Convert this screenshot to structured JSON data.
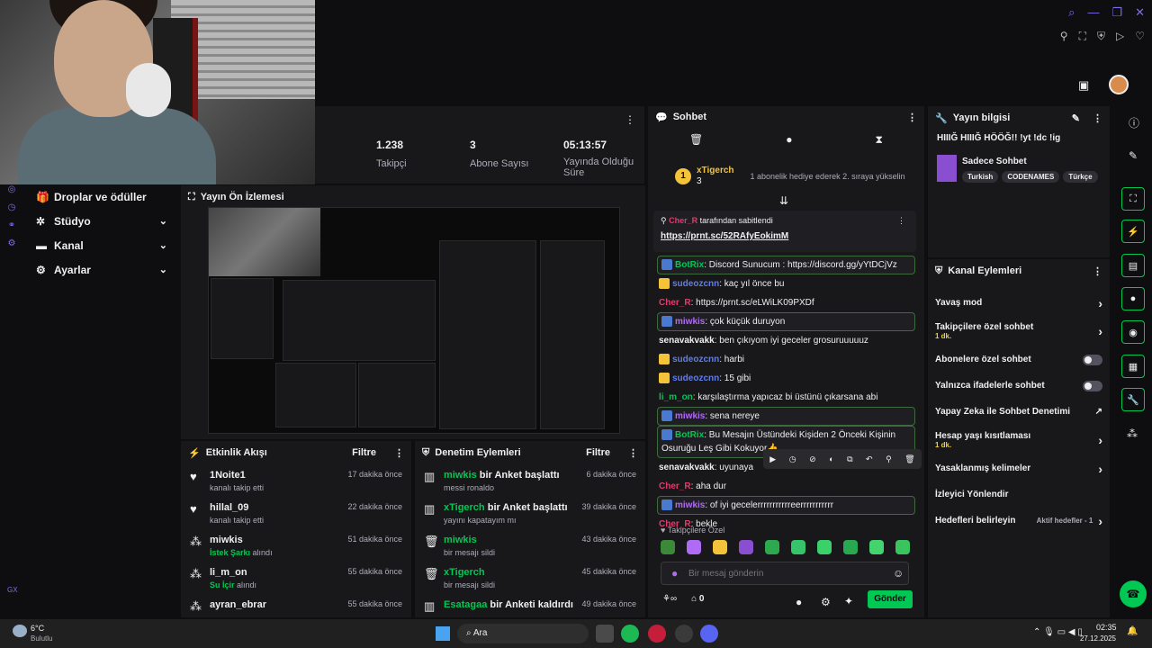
{
  "top": {
    "icons": [
      "search-icon",
      "minimize-icon",
      "restore-icon",
      "close-icon"
    ],
    "toolbar_icons": [
      "pin-icon",
      "crop-icon",
      "shield-icon",
      "play-icon",
      "heart-icon"
    ]
  },
  "side_nav": {
    "items": [
      {
        "label": "Droplar ve ödüller",
        "icon": "gift-icon"
      },
      {
        "label": "Stüdyo",
        "icon": "studio-icon"
      },
      {
        "label": "Kanal",
        "icon": "channel-icon"
      },
      {
        "label": "Ayarlar",
        "icon": "gear-icon"
      }
    ]
  },
  "stats": [
    {
      "value": "1.238",
      "label": "Takipçi"
    },
    {
      "value": "3",
      "label": "Abone Sayısı"
    },
    {
      "value": "05:13:57",
      "label": "Yayında Olduğu Süre"
    }
  ],
  "preview": {
    "title": "Yayın Ön İzlemesi"
  },
  "feed": {
    "title": "Etkinlik Akışı",
    "filter": "Filtre",
    "items": [
      {
        "name": "1Noite1",
        "sub": "kanalı takip etti",
        "time": "17 dakika önce",
        "icon": "heart-icon"
      },
      {
        "name": "hillal_09",
        "sub": "kanalı takip etti",
        "time": "22 dakika önce",
        "icon": "heart-icon"
      },
      {
        "name": "miwkis",
        "sub_hl": "İstek Şarkı",
        "sub": "alındı",
        "time": "51 dakika önce",
        "icon": "points-icon"
      },
      {
        "name": "li_m_on",
        "sub_hl": "Su İçir",
        "sub": "alındı",
        "time": "55 dakika önce",
        "icon": "points-icon"
      },
      {
        "name": "ayran_ebrar",
        "sub": "",
        "time": "55 dakika önce",
        "icon": "points-icon"
      }
    ]
  },
  "mod": {
    "title": "Denetim Eylemleri",
    "filter": "Filtre",
    "items": [
      {
        "name": "miwkis",
        "action": "bir Anket başlattı",
        "sub": "messi ronaldo",
        "time": "6 dakika önce",
        "icon": "poll-icon"
      },
      {
        "name": "xTigerch",
        "action": "bir Anket başlattı",
        "sub": "yayını kapatayım mı",
        "time": "39 dakika önce",
        "icon": "poll-icon"
      },
      {
        "name": "miwkis",
        "action": "",
        "sub": "bir mesajı sildi",
        "time": "43 dakika önce",
        "icon": "trash-icon"
      },
      {
        "name": "xTigerch",
        "action": "",
        "sub": "bir mesajı sildi",
        "time": "45 dakika önce",
        "icon": "trash-icon"
      },
      {
        "name": "Esatagaa",
        "action": "bir Anketi kaldırdı",
        "sub": "",
        "time": "49 dakika önce",
        "icon": "poll-icon"
      }
    ]
  },
  "chat": {
    "title": "Sohbet",
    "gift_user": "xTigerch",
    "gift_count": "3",
    "gift_text": "1 abonelik hediye ederek 2. sıraya yükselin",
    "pinned_by": "Cher_R",
    "pinned_label": "tarafından sabitlendi",
    "pinned_link": "https://prnt.sc/52RAfyEokimM",
    "messages": [
      {
        "user": "BotRix",
        "cls": "u-green",
        "text": ": Discord Sunucum : https://discord.gg/yYtDCjVz",
        "hl": true
      },
      {
        "user": "sudeozcnn",
        "cls": "u-blue",
        "text": ": kaç yıl önce bu",
        "hl": false
      },
      {
        "user": "Cher_R",
        "cls": "u-pink",
        "text": ": https://prnt.sc/eLWiLK09PXDf",
        "hl": false
      },
      {
        "user": "miwkis",
        "cls": "u-purple",
        "text": ": çok küçük duruyon",
        "hl": true
      },
      {
        "user": "senavakvakk",
        "cls": "u-white",
        "text": ": ben çıkıyom iyi geceler grosuruuuuuz",
        "hl": false
      },
      {
        "user": "sudeozcnn",
        "cls": "u-blue",
        "text": ": harbi",
        "hl": false
      },
      {
        "user": "sudeozcnn",
        "cls": "u-blue",
        "text": ": 15 gibi",
        "hl": false
      },
      {
        "user": "li_m_on",
        "cls": "u-green",
        "text": ": karşılaştırma yapıcaz bi üstünü çıkarsana abi",
        "hl": false
      },
      {
        "user": "miwkis",
        "cls": "u-purple",
        "text": ": sena nereye",
        "hl": true
      },
      {
        "user": "BotRix",
        "cls": "u-green",
        "text": ": Bu Mesajın Üstündeki Kişiden 2 Önceki Kişinin Osuruğu Leş Gibi Kokuyor👍",
        "hl": true
      },
      {
        "user": "senavakvakk",
        "cls": "u-white",
        "text": ": uyunaya",
        "hl": false
      },
      {
        "user": "Cher_R",
        "cls": "u-pink",
        "text": ": aha dur",
        "hl": false
      },
      {
        "user": "miwkis",
        "cls": "u-purple",
        "text": ": of iyi gecelerrrrrrrrrrreerrrrrrrrrrr",
        "hl": true
      },
      {
        "user": "Cher_R",
        "cls": "u-pink",
        "text": ": bekle",
        "hl": false
      }
    ],
    "followers_only": "Takipçilere Özel",
    "input_placeholder": "Bir mesaj gönderin",
    "points": "0",
    "send": "Gönder"
  },
  "info": {
    "title": "Yayın bilgisi",
    "stream_title": "HIIIĞ HIIIĞ HÖÖĞ!! !yt !dc !ig",
    "category": "Sadece Sohbet",
    "tags": [
      "Turkish",
      "CODENAMES",
      "Türkçe"
    ]
  },
  "actions": {
    "title": "Kanal Eylemleri",
    "items": [
      {
        "label": "Yavaş mod",
        "sub": "",
        "ctrl": "chev"
      },
      {
        "label": "Takipçilere özel sohbet",
        "sub": "1 dk.",
        "ctrl": "chev"
      },
      {
        "label": "Abonelere özel sohbet",
        "sub": "",
        "ctrl": "toggle"
      },
      {
        "label": "Yalnızca ifadelerle sohbet",
        "sub": "",
        "ctrl": "toggle"
      },
      {
        "label": "Yapay Zeka ile Sohbet Denetimi",
        "sub": "",
        "ctrl": "ext"
      },
      {
        "label": "Hesap yaşı kısıtlaması",
        "sub": "1 dk.",
        "ctrl": "chev"
      },
      {
        "label": "Yasaklanmış kelimeler",
        "sub": "",
        "ctrl": "chev"
      },
      {
        "label": "İzleyici Yönlendir",
        "sub": "",
        "ctrl": ""
      },
      {
        "label": "Hedefleri belirleyin",
        "sub": "",
        "ctrl": "goals",
        "goals": "Aktif hedefler - 1"
      }
    ]
  },
  "taskbar": {
    "weather_temp": "6°C",
    "weather_desc": "Bulutlu",
    "search": "Ara",
    "time": "02:35",
    "date": "27.12.2025"
  }
}
